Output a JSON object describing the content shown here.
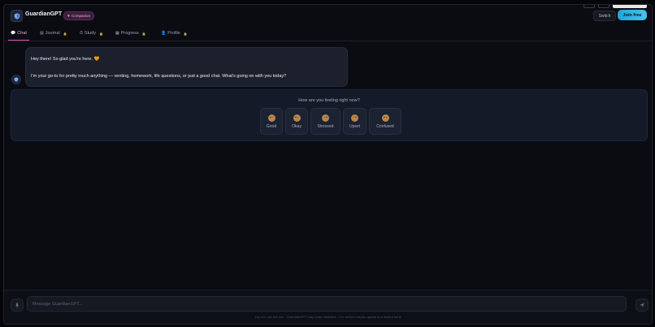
{
  "header": {
    "app_name": "GuardianGPT",
    "badge": "Companion",
    "switch_label": "Switch",
    "join_label": "Join free"
  },
  "tabs": [
    {
      "label": "Chat",
      "icon": "chat-bubble-icon",
      "active": true
    },
    {
      "label": "Journal",
      "icon": "book-icon",
      "locked": true
    },
    {
      "label": "Study",
      "icon": "stopwatch-icon",
      "locked": true
    },
    {
      "label": "Progress",
      "icon": "chart-icon",
      "locked": true
    },
    {
      "label": "Profile",
      "icon": "user-icon",
      "locked": true
    }
  ],
  "chat": {
    "message_line1": "Hey there! So glad you're here. 🧡",
    "message_line2": "I'm your go-to for pretty much anything — venting, homework, life questions, or just a good chat. What's going on with you today?"
  },
  "mood": {
    "question": "How are you feeling right now?",
    "options": [
      "Good",
      "Okay",
      "Stressed",
      "Upset",
      "Confused"
    ]
  },
  "composer": {
    "placeholder": "Message GuardianGPT...",
    "disclaimer": "Tap a to use the mic · GuardianGPT may make mistakes · For serious issues, speak to a trusted adult"
  },
  "colors": {
    "accent_pink": "#e94fae",
    "join_blue": "#1fa6d8",
    "background": "#0a0c12"
  }
}
